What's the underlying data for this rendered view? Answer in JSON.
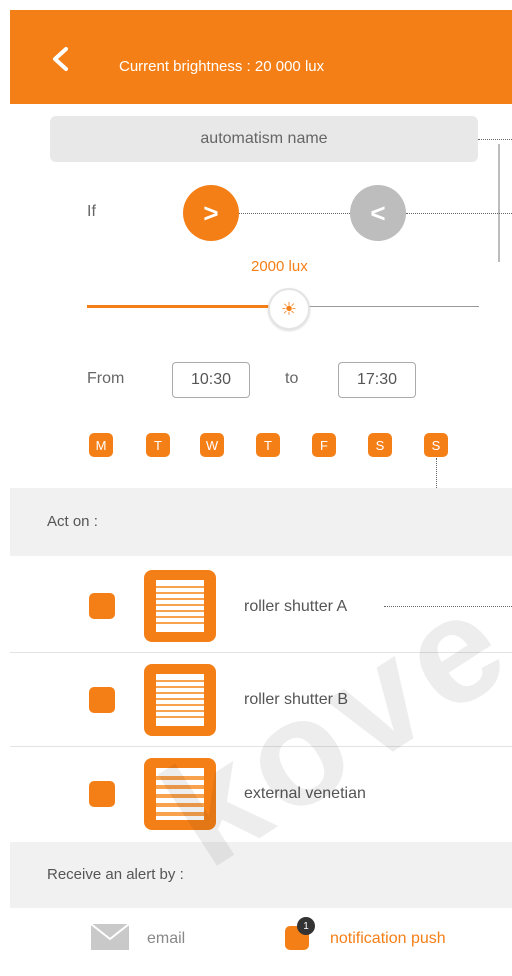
{
  "header": {
    "title": "Current brightness : 20 000 lux",
    "back_icon": "chevron-left-icon",
    "bg_color": "#f57f17"
  },
  "automation": {
    "name_placeholder": "automatism name",
    "if_label": "If",
    "greater_label": ">",
    "less_label": "<",
    "lux_label": "2000 lux",
    "slider_fraction": 0.5,
    "slider_icon": "sun-icon",
    "from_label": "From",
    "from_value": "10:30",
    "to_label": "to",
    "to_value": "17:30",
    "days": [
      "M",
      "T",
      "W",
      "T",
      "F",
      "S",
      "S"
    ]
  },
  "act_on": {
    "label": "Act on :",
    "devices": [
      {
        "label": "roller shutter A",
        "icon": "roller-shutter-icon"
      },
      {
        "label": "roller shutter B",
        "icon": "roller-shutter-icon"
      },
      {
        "label": "external venetian",
        "icon": "venetian-blind-icon"
      }
    ]
  },
  "alert": {
    "label": "Receive an alert by :",
    "email_label": "email",
    "email_icon": "envelope-icon",
    "notification_label": "notification push",
    "notification_badge": "1"
  },
  "watermark": "kove",
  "colors": {
    "accent": "#f57f17",
    "inactive": "#bdbdbd"
  }
}
